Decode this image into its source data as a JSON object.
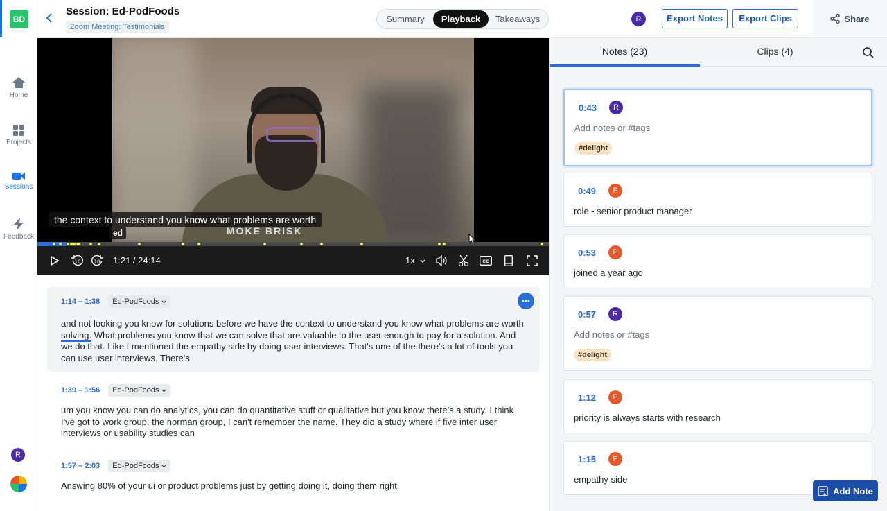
{
  "rail": {
    "workspace": "BD",
    "items": [
      {
        "label": "Home",
        "icon": "home-icon"
      },
      {
        "label": "Projects",
        "icon": "grid-icon"
      },
      {
        "label": "Sessions",
        "icon": "video-icon"
      },
      {
        "label": "Feedback",
        "icon": "bolt-icon"
      }
    ],
    "user_initial": "R"
  },
  "header": {
    "title": "Session: Ed-PodFoods",
    "subtitle": "Zoom Meeting: Testimonials",
    "tabs": [
      "Summary",
      "Playback",
      "Takeaways"
    ],
    "active_tab": "Playback",
    "user_initial": "R",
    "export_notes": "Export Notes",
    "export_clips": "Export Clips",
    "share": "Share"
  },
  "player": {
    "caption_line1": "the context to understand you know what problems are worth",
    "caption_line2": "ed",
    "shirt_text": "MOKE BRISK",
    "current_time": "1:21 / 24:14",
    "speed": "1x",
    "progress_fraction": 0.056,
    "markers": [
      0.033,
      0.045,
      0.06,
      0.066,
      0.072,
      0.078,
      0.081,
      0.105,
      0.121,
      0.199,
      0.284,
      0.316,
      0.445,
      0.516,
      0.556,
      0.634,
      0.786,
      0.795,
      0.986
    ]
  },
  "transcript": [
    {
      "time": "1:14 – 1:38",
      "speaker": "Ed-PodFoods",
      "text_before": "and not looking you know for solutions before we have the context to understand you know what problems are worth ",
      "highlight": "solving.",
      "text_after": " What problems you know that we can solve that are valuable to the user enough to pay for a solution. And we do that. Like I mentioned the empathy side by doing user interviews. That's one of the there's a lot of tools you can use user interviews. There's"
    },
    {
      "time": "1:39 – 1:56",
      "speaker": "Ed-PodFoods",
      "text": "um you know you can do analytics, you can do quantitative stuff or qualitative but you know there's a study. I think I've got to work group, the norman group, I can't remember the name. They did a study where if five inter user interviews or usability studies can"
    },
    {
      "time": "1:57 – 2:03",
      "speaker": "Ed-PodFoods",
      "text": "Answing 80% of your ui or product problems just by getting doing it, doing them right."
    }
  ],
  "panel": {
    "notes_tab": "Notes (23)",
    "clips_tab": "Clips (4)",
    "notes": [
      {
        "time": "0:43",
        "author": "R",
        "author_color": "#4b2aa8",
        "text": "Add notes or #tags",
        "placeholder": true,
        "tag": "#delight"
      },
      {
        "time": "0:49",
        "author": "P",
        "author_color": "#e8572a",
        "text": "role - senior product manager",
        "placeholder": false,
        "tag": ""
      },
      {
        "time": "0:53",
        "author": "P",
        "author_color": "#e8572a",
        "text": "joined a year ago",
        "placeholder": false,
        "tag": ""
      },
      {
        "time": "0:57",
        "author": "R",
        "author_color": "#4b2aa8",
        "text": "Add notes or #tags",
        "placeholder": true,
        "tag": "#delight"
      },
      {
        "time": "1:12",
        "author": "P",
        "author_color": "#e8572a",
        "text": "priority is always starts with research",
        "placeholder": false,
        "tag": ""
      },
      {
        "time": "1:15",
        "author": "P",
        "author_color": "#e8572a",
        "text": "empathy side",
        "placeholder": false,
        "tag": ""
      }
    ],
    "add_note": "Add Note"
  }
}
